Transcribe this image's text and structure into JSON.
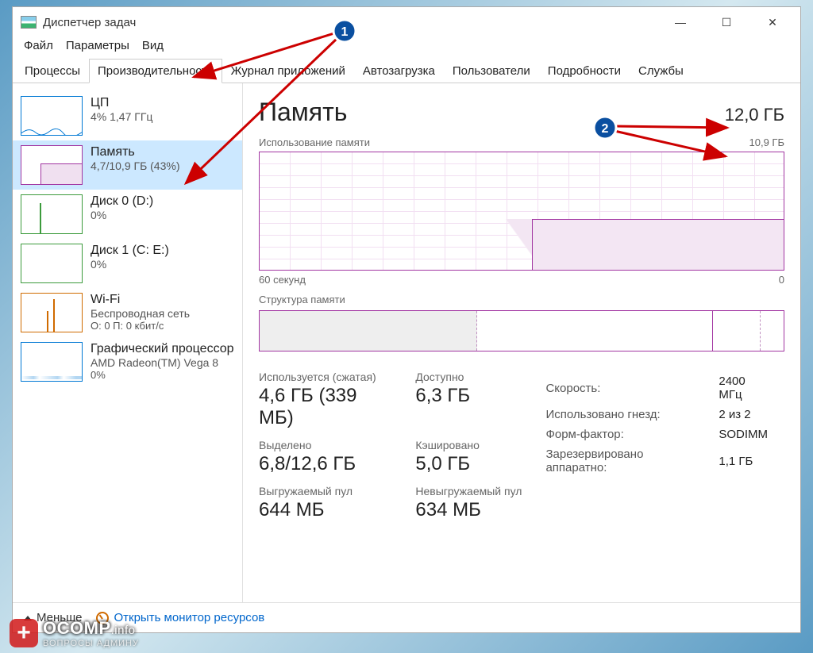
{
  "window": {
    "title": "Диспетчер задач"
  },
  "menu": [
    "Файл",
    "Параметры",
    "Вид"
  ],
  "tabs": [
    "Процессы",
    "Производительность",
    "Журнал приложений",
    "Автозагрузка",
    "Пользователи",
    "Подробности",
    "Службы"
  ],
  "active_tab_index": 1,
  "sidebar": [
    {
      "title": "ЦП",
      "sub": "4%  1,47 ГГц",
      "kind": "cpu"
    },
    {
      "title": "Память",
      "sub": "4,7/10,9 ГБ (43%)",
      "kind": "mem",
      "selected": true
    },
    {
      "title": "Диск 0 (D:)",
      "sub": "0%",
      "kind": "disk"
    },
    {
      "title": "Диск 1 (C: E:)",
      "sub": "0%",
      "kind": "disk"
    },
    {
      "title": "Wi-Fi",
      "sub": "Беспроводная сеть",
      "sub2": "О: 0 П: 0 кбит/с",
      "kind": "wifi"
    },
    {
      "title": "Графический процессор",
      "sub": "AMD Radeon(TM) Vega 8",
      "sub2": "0%",
      "kind": "gpu"
    }
  ],
  "main": {
    "title": "Память",
    "total": "12,0 ГБ",
    "usage_label": "Использование памяти",
    "usage_max": "10,9 ГБ",
    "axis_left": "60 секунд",
    "axis_right": "0",
    "composition_label": "Структура памяти",
    "stats": {
      "used_label": "Используется (сжатая)",
      "used_val": "4,6 ГБ (339 МБ)",
      "avail_label": "Доступно",
      "avail_val": "6,3 ГБ",
      "commit_label": "Выделено",
      "commit_val": "6,8/12,6 ГБ",
      "cached_label": "Кэшировано",
      "cached_val": "5,0 ГБ",
      "paged_label": "Выгружаемый пул",
      "paged_val": "644 МБ",
      "nonpaged_label": "Невыгружаемый пул",
      "nonpaged_val": "634 МБ"
    },
    "right": {
      "speed_label": "Скорость:",
      "speed_val": "2400 МГц",
      "slots_label": "Использовано гнезд:",
      "slots_val": "2 из 2",
      "form_label": "Форм-фактор:",
      "form_val": "SODIMM",
      "reserved_label": "Зарезервировано аппаратно:",
      "reserved_val": "1,1 ГБ"
    }
  },
  "bottom": {
    "less": "Меньше",
    "resmon": "Открыть монитор ресурсов"
  },
  "chart_data": {
    "type": "area",
    "title": "Использование памяти",
    "ylabel": "ГБ",
    "ylim": [
      0,
      10.9
    ],
    "xlim_seconds": [
      60,
      0
    ],
    "series": [
      {
        "name": "Память",
        "approx_current_gb": 4.7,
        "approx_percent": 43
      }
    ],
    "composition": {
      "used_gb": 4.6,
      "cached_gb": 5.0,
      "free_gb": 1.3,
      "hardware_reserved_gb": 1.1,
      "total_visible_gb": 10.9
    }
  },
  "watermark": {
    "text": "OCOMP",
    "suffix": ".info",
    "sub": "ВОПРОСЫ АДМИНУ"
  },
  "annotations": {
    "badge1": "1",
    "badge2": "2"
  }
}
